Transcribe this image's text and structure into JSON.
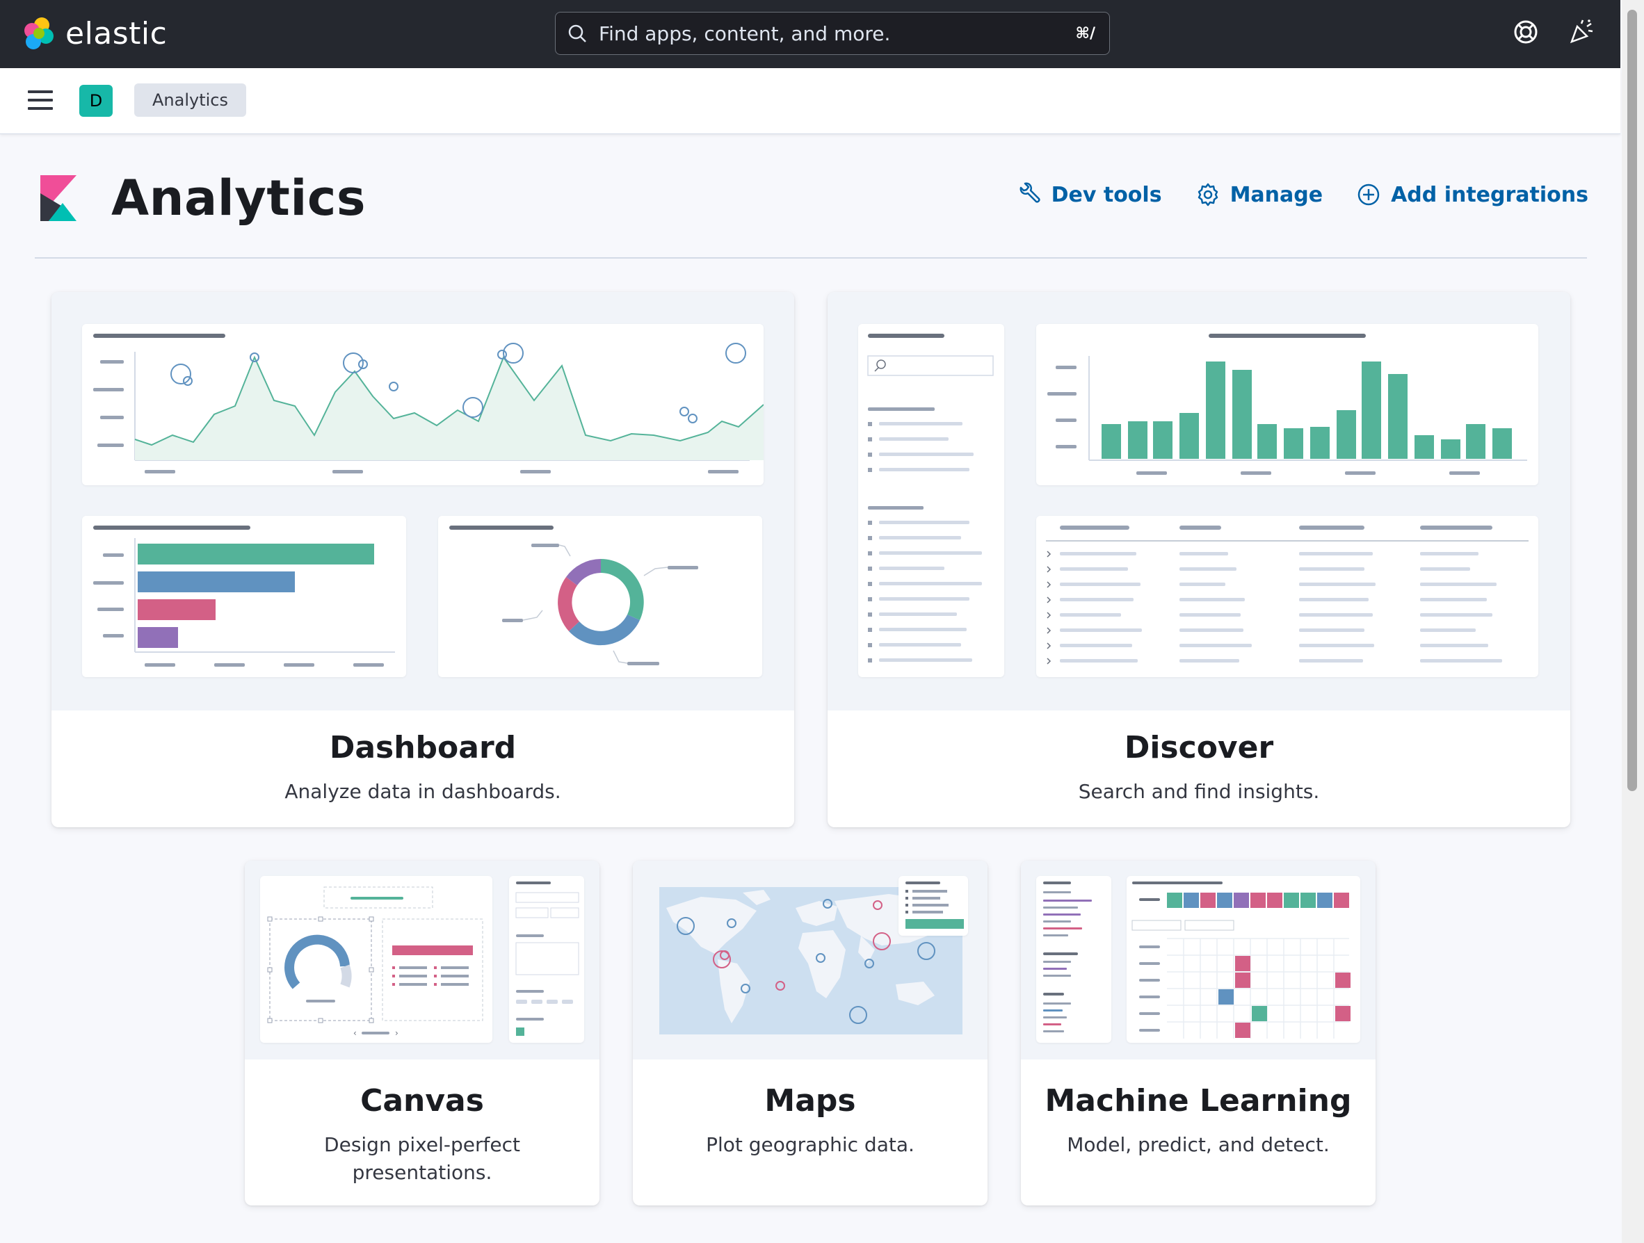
{
  "header": {
    "brand": "elastic",
    "search_placeholder": "Find apps, content, and more.",
    "search_shortcut": "⌘/",
    "help_icon": "help-lifebuoy-icon",
    "news_icon": "newsfeed-party-icon"
  },
  "subbar": {
    "space_initial": "D",
    "breadcrumb": "Analytics"
  },
  "page": {
    "title": "Analytics",
    "links": [
      {
        "label": "Dev tools",
        "icon": "wrench-icon"
      },
      {
        "label": "Manage",
        "icon": "gear-icon"
      },
      {
        "label": "Add integrations",
        "icon": "plus-circle-icon"
      }
    ]
  },
  "cards": [
    {
      "title": "Dashboard",
      "description": "Analyze data in dashboards."
    },
    {
      "title": "Discover",
      "description": "Search and find insights."
    },
    {
      "title": "Canvas",
      "description": "Design pixel-perfect presentations."
    },
    {
      "title": "Maps",
      "description": "Plot geographic data."
    },
    {
      "title": "Machine Learning",
      "description": "Model, predict, and detect."
    }
  ],
  "colors": {
    "accent": "#0061a6",
    "green": "#54b399",
    "blue": "#6092c0",
    "pink": "#d36086",
    "purple": "#9170b8",
    "teal": "#17b8a8"
  }
}
